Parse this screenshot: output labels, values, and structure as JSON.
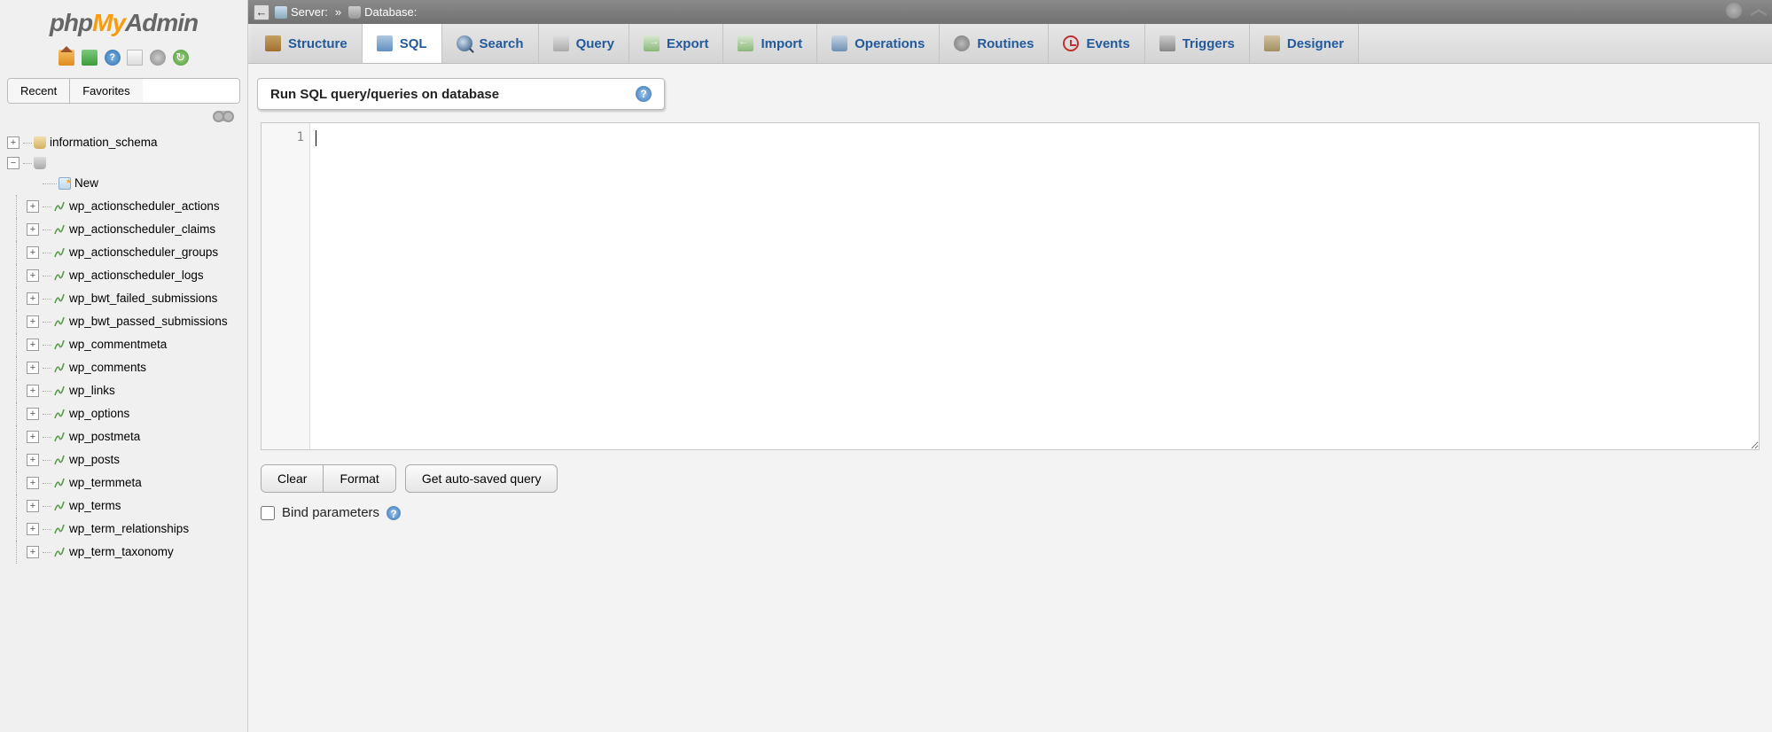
{
  "logo": {
    "part1": "php",
    "part2": "My",
    "part3": "Admin"
  },
  "sidebar": {
    "recent_label": "Recent",
    "favorites_label": "Favorites",
    "db_information_schema": "information_schema",
    "new_label": "New",
    "tables": [
      "wp_actionscheduler_actions",
      "wp_actionscheduler_claims",
      "wp_actionscheduler_groups",
      "wp_actionscheduler_logs",
      "wp_bwt_failed_submissions",
      "wp_bwt_passed_submissions",
      "wp_commentmeta",
      "wp_comments",
      "wp_links",
      "wp_options",
      "wp_postmeta",
      "wp_posts",
      "wp_termmeta",
      "wp_terms",
      "wp_term_relationships",
      "wp_term_taxonomy"
    ]
  },
  "breadcrumb": {
    "server_label": "Server:",
    "separator": "»",
    "database_label": "Database:"
  },
  "tabs": [
    {
      "label": "Structure",
      "icon": "ti-structure"
    },
    {
      "label": "SQL",
      "icon": "ti-sql",
      "active": true
    },
    {
      "label": "Search",
      "icon": "ti-search"
    },
    {
      "label": "Query",
      "icon": "ti-query"
    },
    {
      "label": "Export",
      "icon": "ti-export"
    },
    {
      "label": "Import",
      "icon": "ti-import"
    },
    {
      "label": "Operations",
      "icon": "ti-operations"
    },
    {
      "label": "Routines",
      "icon": "ti-routines"
    },
    {
      "label": "Events",
      "icon": "ti-events"
    },
    {
      "label": "Triggers",
      "icon": "ti-triggers"
    },
    {
      "label": "Designer",
      "icon": "ti-designer"
    }
  ],
  "query_panel": {
    "title": "Run SQL query/queries on database",
    "line_number": "1"
  },
  "buttons": {
    "clear": "Clear",
    "format": "Format",
    "autosaved": "Get auto-saved query"
  },
  "bind_parameters_label": "Bind parameters"
}
